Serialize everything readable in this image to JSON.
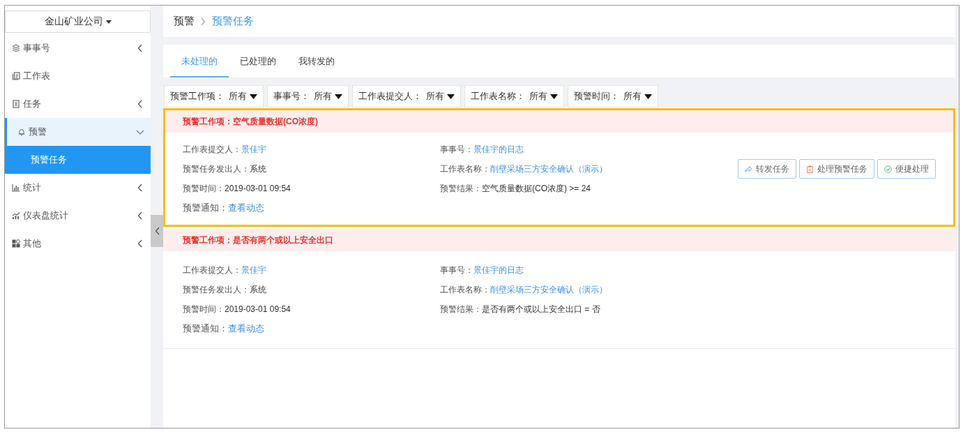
{
  "sidebar": {
    "company": "金山矿业公司",
    "items": [
      {
        "label": "事事号",
        "kind": "group",
        "expanded": false
      },
      {
        "label": "工作表",
        "kind": "link",
        "expanded": false
      },
      {
        "label": "任务",
        "kind": "group",
        "expanded": false
      },
      {
        "label": "预警",
        "kind": "group",
        "expanded": true,
        "children": [
          {
            "label": "预警任务",
            "selected": true
          }
        ]
      },
      {
        "label": "统计",
        "kind": "group",
        "expanded": false
      },
      {
        "label": "仪表盘统计",
        "kind": "group",
        "expanded": false
      },
      {
        "label": "其他",
        "kind": "group",
        "expanded": false
      }
    ]
  },
  "breadcrumb": [
    {
      "label": "预警",
      "current": false
    },
    {
      "label": "预警任务",
      "current": true
    }
  ],
  "tabs": [
    {
      "label": "未处理的",
      "selected": true
    },
    {
      "label": "已处理的",
      "selected": false
    },
    {
      "label": "我转发的",
      "selected": false
    }
  ],
  "filters": [
    {
      "label": "预警工作项：",
      "value": "所有"
    },
    {
      "label": "事事号：",
      "value": "所有"
    },
    {
      "label": "工作表提交人：",
      "value": "所有"
    },
    {
      "label": "工作表名称：",
      "value": "所有"
    },
    {
      "label": "预警时间：",
      "value": "所有"
    }
  ],
  "alerts": [
    {
      "title": "预警工作项：空气质量数据(CO浓度)",
      "highlighted": true,
      "fields": [
        {
          "label": "工作表提交人：",
          "value": "景佳宇",
          "link": true
        },
        {
          "label": "事事号：",
          "value": "景佳宇的日志",
          "link": true
        },
        {
          "label": "预警任务发出人：",
          "value": "系统",
          "link": false
        },
        {
          "label": "工作表名称：",
          "value": "削壁采场三方安全确认（演示）",
          "link": true
        },
        {
          "label": "预警时间：",
          "value": "2019-03-01 09:54",
          "link": false
        },
        {
          "label": "预警结果：",
          "value": "空气质量数据(CO浓度) >= 24",
          "link": false
        }
      ],
      "notice": {
        "label": "预警通知：",
        "link": "查看动态"
      },
      "buttons": [
        {
          "label": "转发任务"
        },
        {
          "label": "处理预警任务"
        },
        {
          "label": "便捷处理"
        }
      ]
    },
    {
      "title": "预警工作项：是否有两个或以上安全出口",
      "highlighted": false,
      "fields": [
        {
          "label": "工作表提交人：",
          "value": "景佳宇",
          "link": true
        },
        {
          "label": "事事号：",
          "value": "景佳宇的日志",
          "link": true
        },
        {
          "label": "预警任务发出人：",
          "value": "系统",
          "link": false
        },
        {
          "label": "工作表名称：",
          "value": "削壁采场三方安全确认（演示）",
          "link": true
        },
        {
          "label": "预警时间：",
          "value": "2019-03-01 09:54",
          "link": false
        },
        {
          "label": "预警结果：",
          "value": "是否有两个或以上安全出口 = 否",
          "link": false
        }
      ],
      "notice": {
        "label": "预警通知：",
        "link": "查看动态"
      }
    }
  ]
}
